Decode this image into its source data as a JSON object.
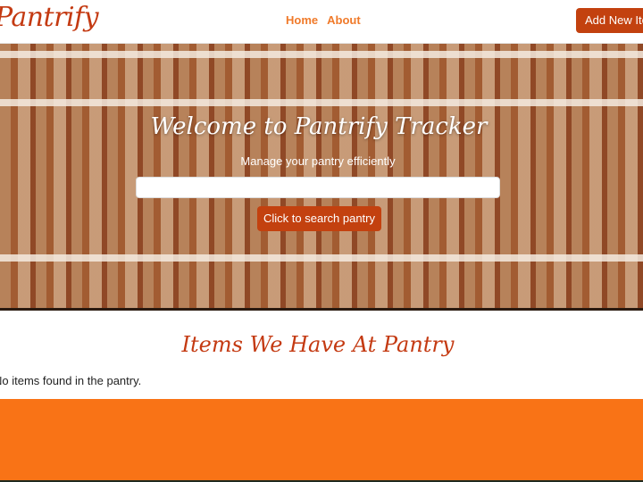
{
  "navbar": {
    "brand": "Pantrify",
    "links": [
      "Home",
      "About"
    ],
    "add_button": "Add New Item"
  },
  "hero": {
    "title": "Welcome to Pantrify Tracker",
    "subtitle": "Manage your pantry efficiently",
    "search_value": "",
    "search_button": "Click to search pantry"
  },
  "items": {
    "title": "Items We Have At Pantry",
    "empty_message": "No items found in the pantry."
  },
  "colors": {
    "brand": "#c43a12",
    "nav_link": "#f07a2a",
    "button": "#c3410f",
    "footer": "#f97316"
  }
}
